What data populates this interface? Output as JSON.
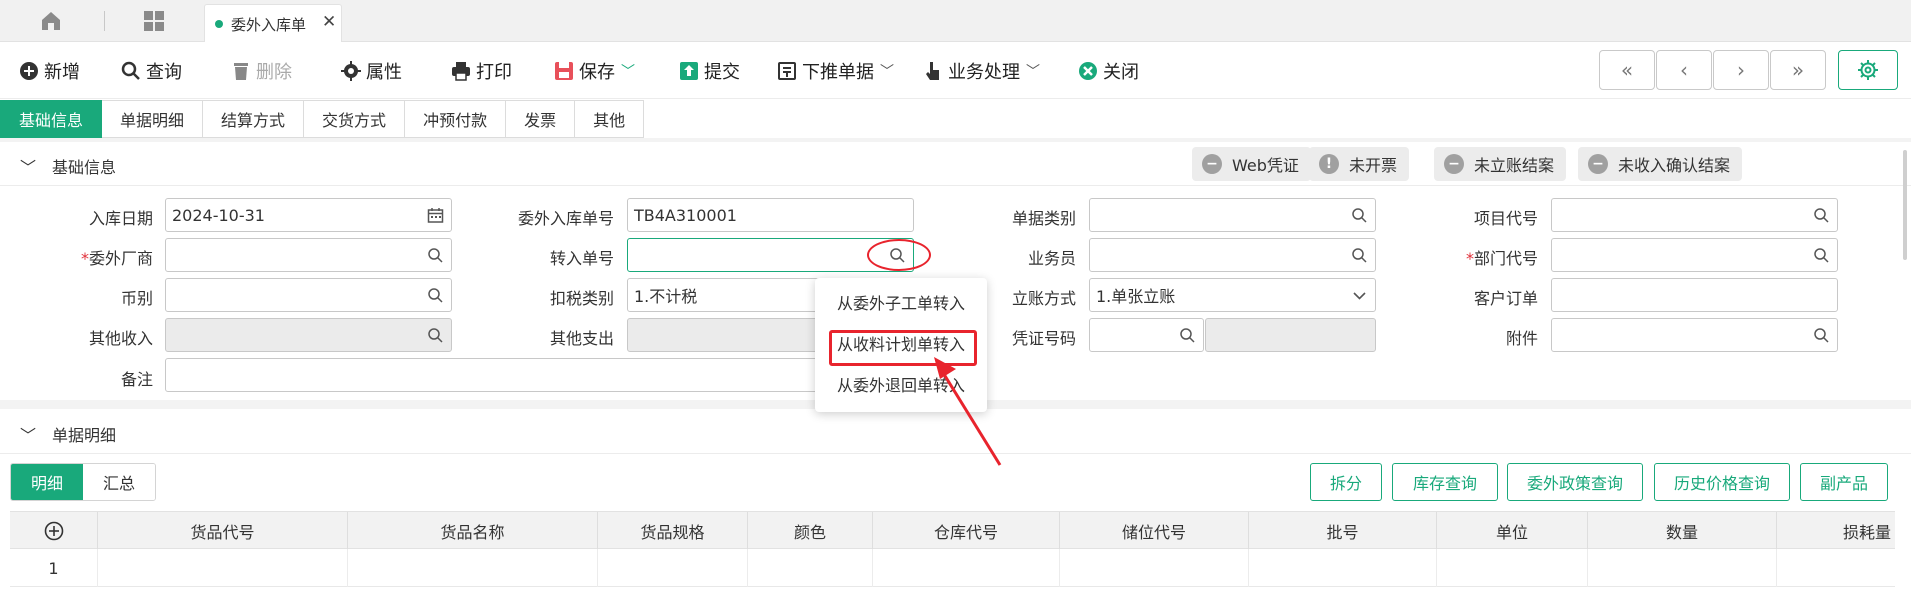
{
  "tabbar": {
    "open_tab": "委外入库单"
  },
  "toolbar": {
    "add": "新增",
    "query": "查询",
    "delete": "删除",
    "property": "属性",
    "print": "打印",
    "save": "保存",
    "submit": "提交",
    "push": "下推单据",
    "process": "业务处理",
    "close": "关闭",
    "nav": [
      "«",
      "‹",
      "›",
      "»"
    ]
  },
  "section_tabs": [
    "基础信息",
    "单据明细",
    "结算方式",
    "交货方式",
    "冲预付款",
    "发票",
    "其他"
  ],
  "basic": {
    "title": "基础信息",
    "badges": [
      "Web凭证",
      "未开票",
      "未立账结案",
      "未收入确认结案"
    ],
    "fields": {
      "in_date": {
        "label": "入库日期",
        "value": "2024-10-31"
      },
      "order_no": {
        "label": "委外入库单号",
        "value": "TB4A310001"
      },
      "doc_type": {
        "label": "单据类别",
        "value": ""
      },
      "project": {
        "label": "项目代号",
        "value": ""
      },
      "vendor": {
        "label": "委外厂商",
        "value": ""
      },
      "transfer_no": {
        "label": "转入单号",
        "value": ""
      },
      "staff": {
        "label": "业务员",
        "value": ""
      },
      "dept": {
        "label": "部门代号",
        "value": ""
      },
      "currency": {
        "label": "币别",
        "value": ""
      },
      "tax_type": {
        "label": "扣税类别",
        "value": "1.不计税"
      },
      "account_mode": {
        "label": "立账方式",
        "value": "1.单张立账"
      },
      "customer_order": {
        "label": "客户订单",
        "value": ""
      },
      "other_income": {
        "label": "其他收入",
        "value": ""
      },
      "other_expense": {
        "label": "其他支出",
        "value": ""
      },
      "voucher_no": {
        "label": "凭证号码",
        "value": ""
      },
      "attachment": {
        "label": "附件",
        "value": ""
      },
      "remark": {
        "label": "备注",
        "value": ""
      }
    },
    "required_mark": "*"
  },
  "dropdown": [
    "从委外子工单转入",
    "从收料计划单转入",
    "从委外退回单转入"
  ],
  "detail": {
    "title": "单据明细",
    "subtabs": [
      "明细",
      "汇总"
    ],
    "buttons": [
      "拆分",
      "库存查询",
      "委外政策查询",
      "历史价格查询",
      "副产品"
    ],
    "columns": [
      "货品代号",
      "货品名称",
      "货品规格",
      "颜色",
      "仓库代号",
      "储位代号",
      "批号",
      "单位",
      "数量",
      "损耗量"
    ],
    "row_no": "1"
  },
  "colors": {
    "accent": "#19a97b",
    "highlight": "#e8242d"
  }
}
